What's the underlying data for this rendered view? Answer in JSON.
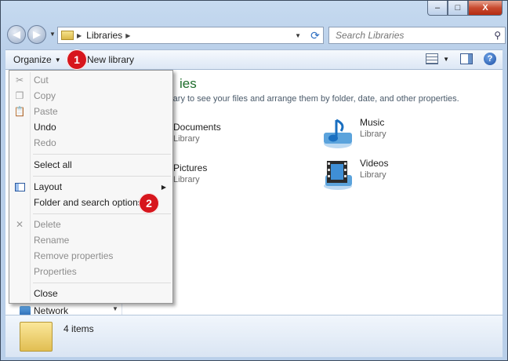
{
  "window": {
    "caption_buttons": {
      "minimize": "–",
      "maximize": "□",
      "close": "X"
    }
  },
  "nav": {
    "back_icon": "arrow-left-icon",
    "forward_icon": "arrow-right-icon",
    "address_crumb": "Libraries",
    "search_placeholder": "Search Libraries"
  },
  "command_bar": {
    "organize_label": "Organize",
    "new_library_label": "New library"
  },
  "organize_menu": {
    "items": [
      {
        "label": "Cut",
        "enabled": false,
        "icon": "scissors-icon"
      },
      {
        "label": "Copy",
        "enabled": false,
        "icon": "copy-icon"
      },
      {
        "label": "Paste",
        "enabled": false,
        "icon": "paste-icon"
      },
      {
        "label": "Undo",
        "enabled": true
      },
      {
        "label": "Redo",
        "enabled": false
      },
      {
        "label": "Select all",
        "enabled": true
      },
      {
        "label": "Layout",
        "enabled": true,
        "icon": "layout-icon",
        "submenu": true
      },
      {
        "label": "Folder and search options",
        "enabled": true
      },
      {
        "label": "Delete",
        "enabled": false,
        "icon": "delete-x-icon"
      },
      {
        "label": "Rename",
        "enabled": false
      },
      {
        "label": "Remove properties",
        "enabled": false
      },
      {
        "label": "Properties",
        "enabled": false
      },
      {
        "label": "Close",
        "enabled": true
      }
    ]
  },
  "content": {
    "heading": "ies",
    "subtitle": "rary to see your files and arrange them by folder, date, and other properties.",
    "libraries": [
      {
        "name": "Documents",
        "type": "Library"
      },
      {
        "name": "Music",
        "type": "Library",
        "icon": "music-note-icon"
      },
      {
        "name": "Pictures",
        "type": "Library"
      },
      {
        "name": "Videos",
        "type": "Library",
        "icon": "film-strip-icon"
      }
    ]
  },
  "nav_pane": {
    "network_label": "Network"
  },
  "status": {
    "item_count": "4 items"
  },
  "badges": {
    "one": "1",
    "two": "2"
  },
  "colors": {
    "badge_red": "#d7161d",
    "heading_green": "#1e6d2b"
  }
}
